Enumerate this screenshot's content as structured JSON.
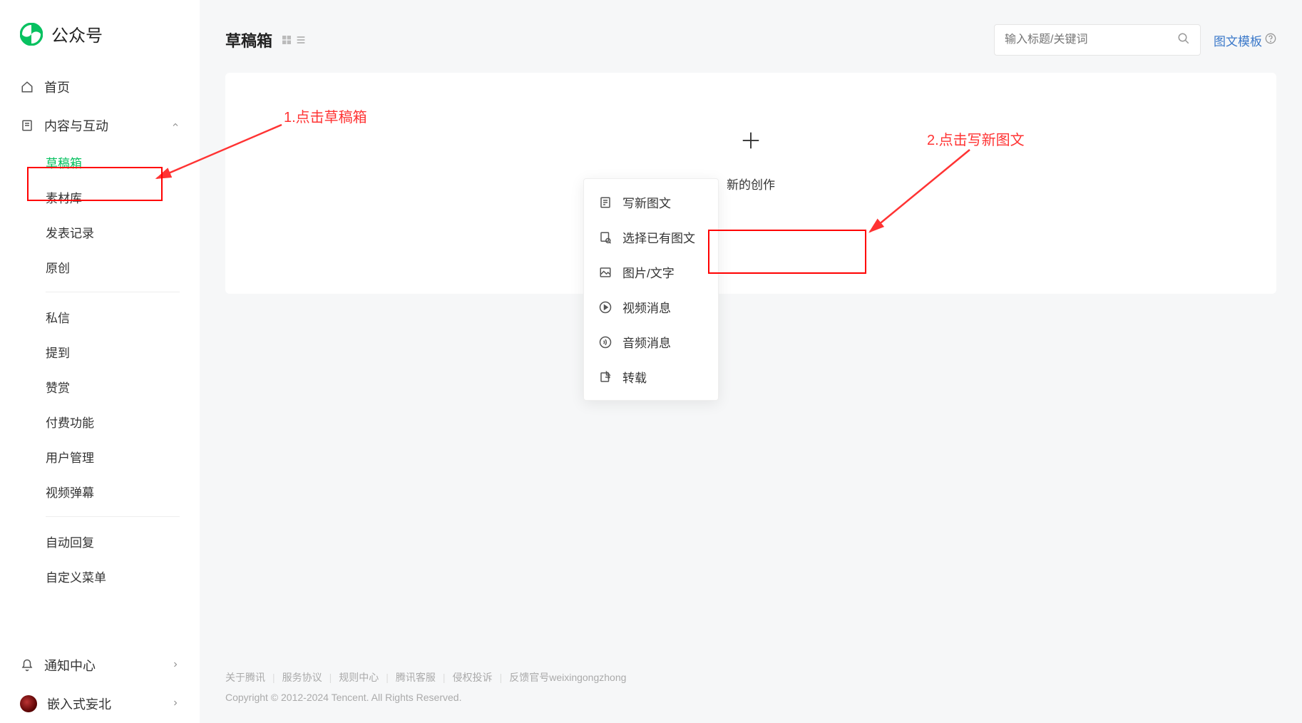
{
  "app": {
    "name": "公众号"
  },
  "sidebar": {
    "home": "首页",
    "content_section": "内容与互动",
    "drafts": "草稿箱",
    "library": "素材库",
    "publish_log": "发表记录",
    "original": "原创",
    "messages": "私信",
    "mentions": "提到",
    "rewards": "赞赏",
    "paid": "付费功能",
    "user_mgmt": "用户管理",
    "video_danmu": "视频弹幕",
    "auto_reply": "自动回复",
    "custom_menu": "自定义菜单",
    "notify": "通知中心",
    "account": "嵌入式妄北"
  },
  "topbar": {
    "title": "草稿箱",
    "search_placeholder": "输入标题/关键词",
    "template_link": "图文模板"
  },
  "create": {
    "new_label": "新的创作",
    "menu": {
      "new_article": "写新图文",
      "choose_existing": "选择已有图文",
      "image_text": "图片/文字",
      "video": "视频消息",
      "audio": "音频消息",
      "repost": "转载"
    }
  },
  "annotations": {
    "step1": "1.点击草稿箱",
    "step2": "2.点击写新图文"
  },
  "footer": {
    "links": [
      "关于腾讯",
      "服务协议",
      "规则中心",
      "腾讯客服",
      "侵权投诉",
      "反馈官号weixingongzhong"
    ],
    "copyright": "Copyright © 2012-2024 Tencent. All Rights Reserved."
  }
}
